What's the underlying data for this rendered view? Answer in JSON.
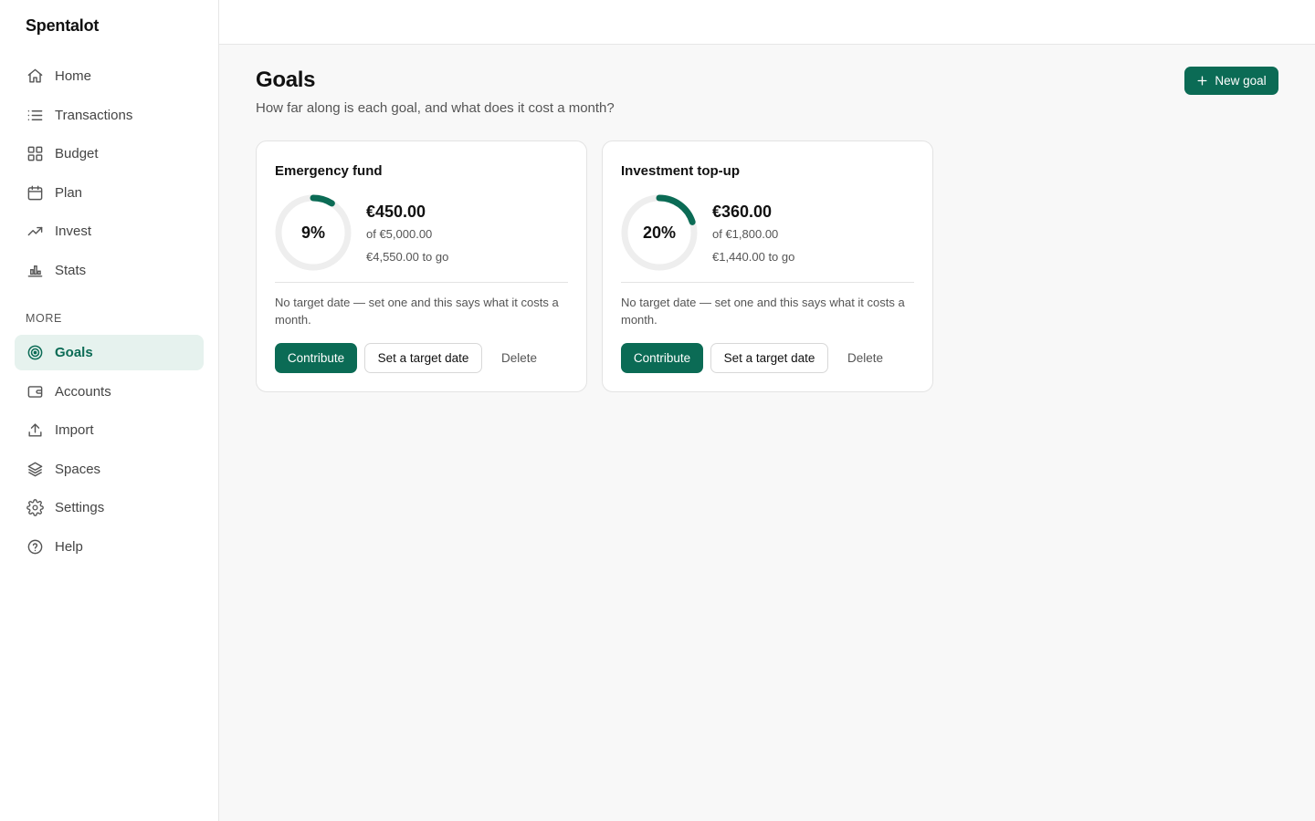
{
  "app": {
    "brand": "Spentalot"
  },
  "sidebar": {
    "primary": [
      {
        "label": "Home",
        "icon": "home-icon"
      },
      {
        "label": "Transactions",
        "icon": "list-icon"
      },
      {
        "label": "Budget",
        "icon": "grid-icon"
      },
      {
        "label": "Plan",
        "icon": "calendar-icon"
      },
      {
        "label": "Invest",
        "icon": "trending-up-icon"
      },
      {
        "label": "Stats",
        "icon": "bar-chart-icon"
      }
    ],
    "section_label": "MORE",
    "secondary": [
      {
        "label": "Goals",
        "icon": "target-icon",
        "active": true
      },
      {
        "label": "Accounts",
        "icon": "wallet-icon"
      },
      {
        "label": "Import",
        "icon": "upload-icon"
      },
      {
        "label": "Spaces",
        "icon": "layers-icon"
      },
      {
        "label": "Settings",
        "icon": "gear-icon"
      },
      {
        "label": "Help",
        "icon": "help-circle-icon"
      }
    ]
  },
  "header": {
    "title": "Goals",
    "subtitle": "How far along is each goal, and what does it cost a month?",
    "new_goal_label": "New goal"
  },
  "goals": [
    {
      "name": "Emergency fund",
      "percent_label": "9%",
      "progress": 0.09,
      "saved": "€450.00",
      "of_target": "of €5,000.00",
      "to_go": "€4,550.00 to go",
      "note": "No target date — set one and this says what it costs a month.",
      "contribute_label": "Contribute",
      "target_date_label": "Set a target date",
      "delete_label": "Delete"
    },
    {
      "name": "Investment top-up",
      "percent_label": "20%",
      "progress": 0.2,
      "saved": "€360.00",
      "of_target": "of €1,800.00",
      "to_go": "€1,440.00 to go",
      "note": "No target date — set one and this says what it costs a month.",
      "contribute_label": "Contribute",
      "target_date_label": "Set a target date",
      "delete_label": "Delete"
    }
  ],
  "colors": {
    "accent": "#0b6b55",
    "accent_soft": "#e6f2ee",
    "ring_track": "#eeeeee"
  }
}
